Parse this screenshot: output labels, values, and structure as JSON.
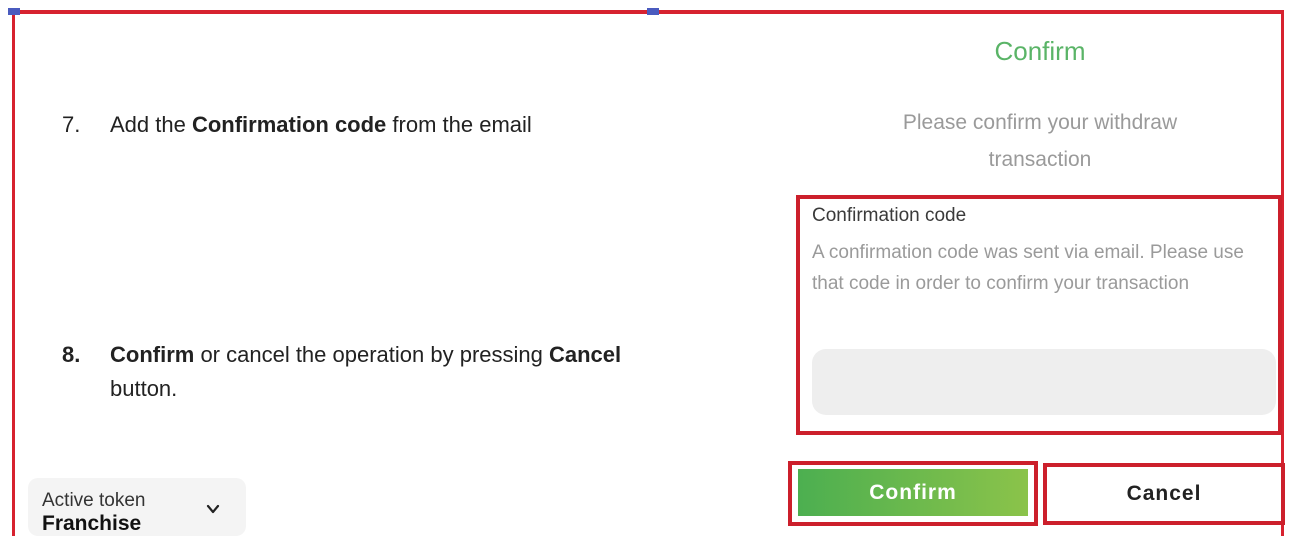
{
  "steps": {
    "step7": {
      "number": "7.",
      "text_before": "Add the ",
      "bold": "Confirmation code",
      "text_after": " from the email"
    },
    "step8": {
      "number": "8.",
      "bold1": "Confirm",
      "text_mid": " or cancel the operation by pressing ",
      "bold2": "Cancel",
      "text_end": "button."
    }
  },
  "dialog": {
    "title": "Confirm",
    "subtitle": "Please confirm your withdraw transaction",
    "field_label": "Confirmation code",
    "field_description": "A confirmation code was sent via email. Please use that code in order to confirm your transaction",
    "field_value": "",
    "field_placeholder": "",
    "confirm_label": "Confirm",
    "cancel_label": "Cancel"
  },
  "token_selector": {
    "label": "Active token",
    "value": "Franchise",
    "icon": "chevron-down-icon"
  },
  "colors": {
    "annotation_red": "#cc1f2b",
    "confirm_green": "#4caf50",
    "title_green": "#5ab467"
  }
}
